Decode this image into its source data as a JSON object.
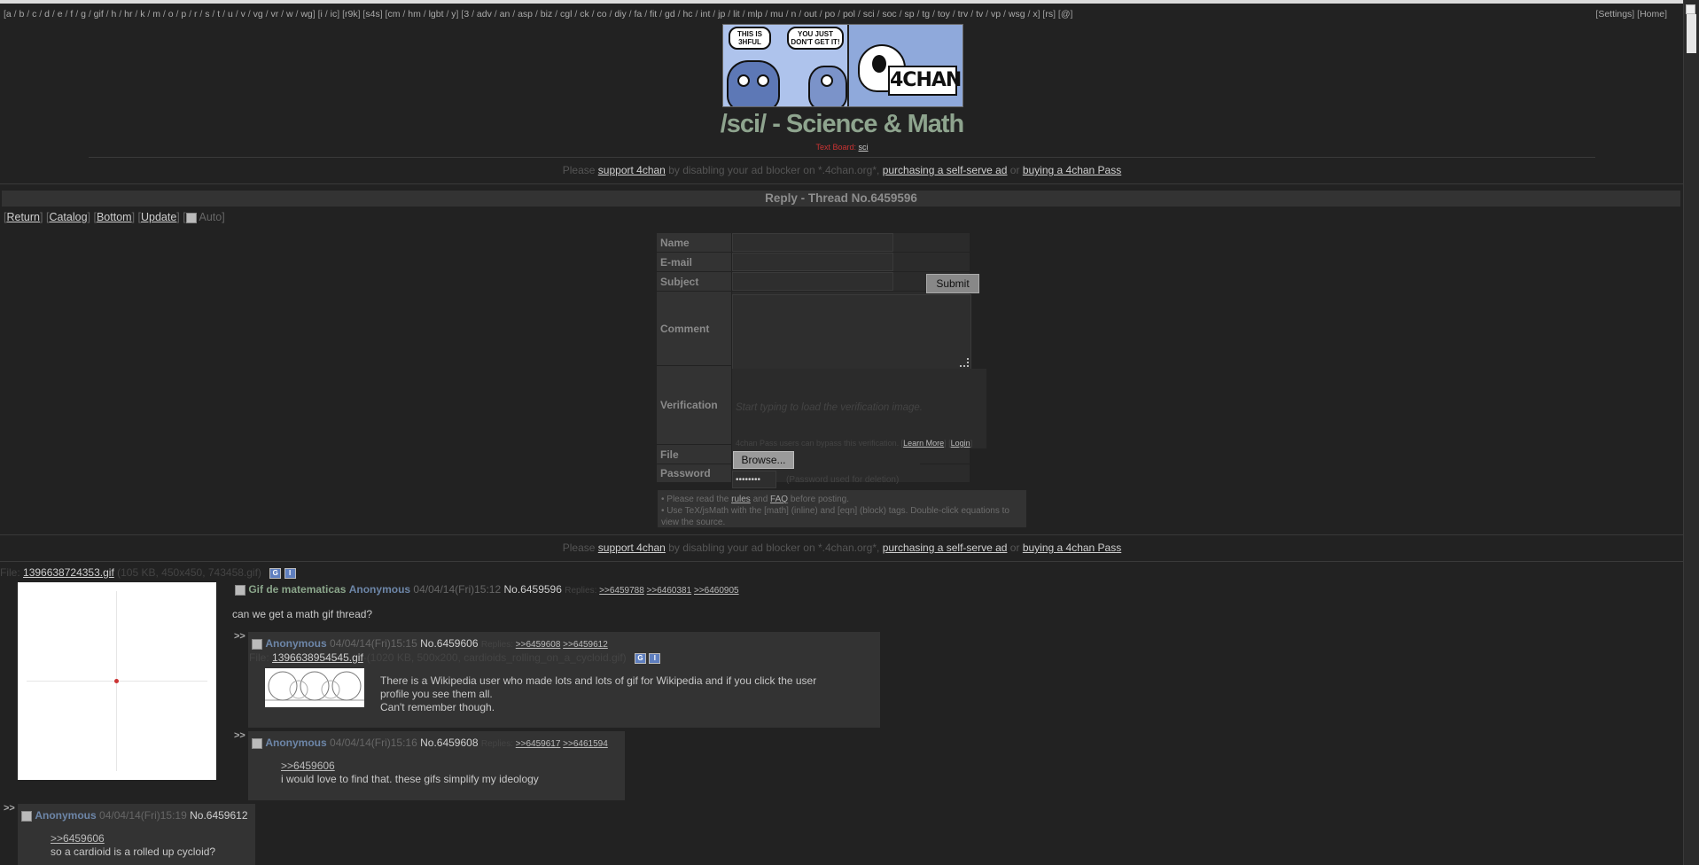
{
  "nav": {
    "groups": [
      [
        "a",
        "b",
        "c",
        "d",
        "e",
        "f",
        "g",
        "gif",
        "h",
        "hr",
        "k",
        "m",
        "o",
        "p",
        "r",
        "s",
        "t",
        "u",
        "v",
        "vg",
        "vr",
        "w",
        "wg"
      ],
      [
        "i",
        "ic"
      ],
      [
        "r9k"
      ],
      [
        "s4s"
      ],
      [
        "cm",
        "hm",
        "lgbt",
        "y"
      ],
      [
        "3",
        "adv",
        "an",
        "asp",
        "biz",
        "cgl",
        "ck",
        "co",
        "diy",
        "fa",
        "fit",
        "gd",
        "hc",
        "int",
        "jp",
        "lit",
        "mlp",
        "mu",
        "n",
        "out",
        "po",
        "pol",
        "sci",
        "soc",
        "sp",
        "tg",
        "toy",
        "trv",
        "tv",
        "vp",
        "wsg",
        "x"
      ],
      [
        "rs"
      ],
      [
        "@"
      ]
    ],
    "settings": "Settings",
    "home": "Home"
  },
  "banner": {
    "bubble1": "THIS IS 3HFUL",
    "bubble2": "YOU JUST DON'T GET IT!",
    "logo": "4CHAN"
  },
  "board": {
    "title": "/sci/ - Science & Math",
    "sub_red": "Text Board:",
    "sub_link": "sci"
  },
  "ad": {
    "please": "Please",
    "support": "support 4chan",
    "by": "by disabling your ad blocker on *.4chan.org*,",
    "purchasing": "purchasing a self-serve ad",
    "or": "or",
    "pass": "buying a 4chan Pass"
  },
  "thread": {
    "bar": "Reply - Thread No.6459596",
    "nav": {
      "return": "Return",
      "catalog": "Catalog",
      "bottom": "Bottom",
      "update": "Update",
      "auto": "Auto"
    }
  },
  "form": {
    "name": "Name",
    "email": "E-mail",
    "subject": "Subject",
    "submit": "Submit",
    "comment": "Comment",
    "verification": "Verification",
    "verif_hint": "Start typing to load the verification image.",
    "pass_text": "4chan Pass users can bypass this verification.",
    "learn_more": "Learn More",
    "login": "Login",
    "file": "File",
    "browse": "Browse...",
    "password": "Password",
    "password_value": "••••••••",
    "password_hint": "(Password used for deletion)",
    "rules1_a": "• Please read the",
    "rules1_rules": "rules",
    "rules1_and": "and",
    "rules1_faq": "FAQ",
    "rules1_b": "before posting.",
    "rules2": "• Use TeX/jsMath with the [math] (inline) and [eqn] (block) tags. Double-click equations to view the source."
  },
  "op": {
    "file_label": "File:",
    "file_name": "1396638724353.gif",
    "file_meta": "(105 KB, 450x450, 743458.gif)",
    "subject": "Gif de matematicas",
    "name": "Anonymous",
    "datetime": "04/04/14(Fri)15:12",
    "number": "No.6459596",
    "replies_label": "Replies:",
    "replies": [
      ">>6459788",
      ">>6460381",
      ">>6460905"
    ],
    "message": "can we get a math gif thread?"
  },
  "posts": [
    {
      "name": "Anonymous",
      "datetime": "04/04/14(Fri)15:15",
      "number": "No.6459606",
      "replies_label": "Replies:",
      "replies": [
        ">>6459608",
        ">>6459612"
      ],
      "file_label": "File:",
      "file_name": "1396638954545.gif",
      "file_meta": "-(1020 KB, 500x200, cardioids_rolling_on_a_cycloid.gif)",
      "lines": [
        "There is a Wikipedia user who made lots and lots of gif for Wikipedia and if you click the user",
        "profile you see them all.",
        "Can't remember though."
      ]
    },
    {
      "name": "Anonymous",
      "datetime": "04/04/14(Fri)15:16",
      "number": "No.6459608",
      "replies_label": "Replies:",
      "replies": [
        ">>6459617",
        ">>6461594"
      ],
      "quote": ">>6459606",
      "lines": [
        "i would love to find that. these gifs simplify my ideology"
      ]
    },
    {
      "name": "Anonymous",
      "datetime": "04/04/14(Fri)15:19",
      "number": "No.6459612",
      "quote": ">>6459606",
      "lines": [
        "so a cardioid is a rolled up cycloid?"
      ]
    }
  ],
  "colors": {
    "bg": "#222222",
    "subject": "#8aa58a",
    "name": "#6d86a8",
    "title": "#8ea48e"
  }
}
